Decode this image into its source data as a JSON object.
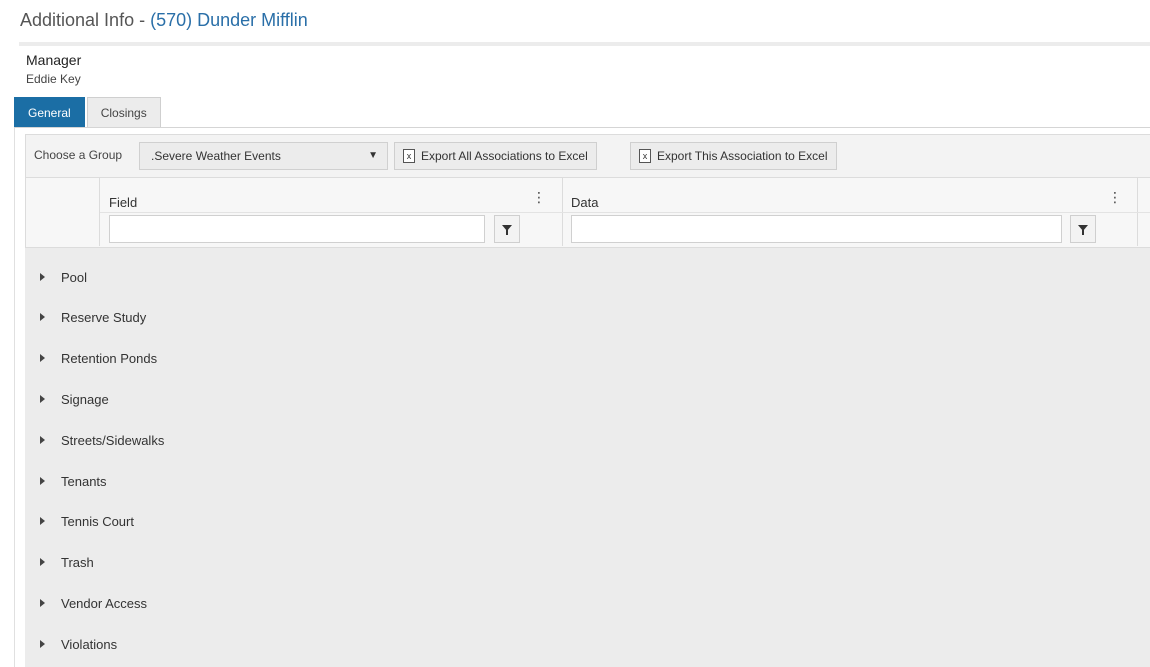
{
  "header": {
    "title_prefix": "Additional Info - ",
    "title_link": "(570) Dunder Mifflin"
  },
  "manager": {
    "label": "Manager",
    "value": "Eddie Key"
  },
  "tabs": [
    {
      "label": "General",
      "active": true
    },
    {
      "label": "Closings",
      "active": false
    }
  ],
  "toolbar": {
    "group_label": "Choose a Group",
    "group_selected": ".Severe Weather Events",
    "export_all_label": "Export All Associations to Excel",
    "export_this_label": "Export This Association to Excel"
  },
  "grid": {
    "columns": [
      {
        "title": "Field",
        "filter_value": ""
      },
      {
        "title": "Data",
        "filter_value": ""
      }
    ],
    "groups": [
      "Pool",
      "Reserve Study",
      "Retention Ponds",
      "Signage",
      "Streets/Sidewalks",
      "Tenants",
      "Tennis Court",
      "Trash",
      "Vendor Access",
      "Violations"
    ]
  },
  "colors": {
    "accent": "#1b6ea5",
    "link": "#2a6fa8",
    "grid_background": "#ececec"
  }
}
